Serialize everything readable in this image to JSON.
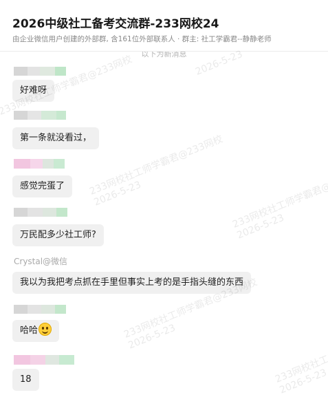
{
  "header": {
    "title": "2026中级社工备考交流群-233网校24",
    "subtitle": "由企业微信用户创建的外部群, 含161位外部联系人 · 群主: 社工学霸君--静静老师"
  },
  "chat": {
    "system_note": "以下为新消息",
    "messages": [
      {
        "sender_colors": [
          "#d6d6d6",
          "#e3e3e3",
          "#dfe9df",
          "#bfe6c8"
        ],
        "text": "好难呀"
      },
      {
        "sender_colors": [
          "#d6d6d6",
          "#e5e5e5",
          "#d4ead8",
          "#c6e8ce"
        ],
        "text": "第一条就没看过，"
      },
      {
        "sender_colors": [
          "#f2c6e0",
          "#f6d6ea",
          "#dde6de",
          "#c9ead2"
        ],
        "text": "感觉完蛋了"
      },
      {
        "sender_colors": [
          "#d6d6d6",
          "#e3e3e3",
          "#dde7de",
          "#c3e7cb"
        ],
        "text": "万民配多少社工师?"
      },
      {
        "sender_text": "Crystal@微信",
        "text": "我以为我把考点抓在手里但事实上考的是手指头缝的东西"
      },
      {
        "sender_colors": [
          "#d6d6d6",
          "#e3e3e3",
          "#dde7de",
          "#c3e7cb"
        ],
        "text": "哈哈",
        "emoji": "grinning-face-icon"
      },
      {
        "sender_colors": [
          "#f2c6e0",
          "#f4d2e6",
          "#dfe7e0",
          "#c7ead1"
        ],
        "text": "18"
      }
    ]
  },
  "watermark": {
    "line1": "233网校社工师学霸君@233网校",
    "line2": "2026-5-23"
  }
}
